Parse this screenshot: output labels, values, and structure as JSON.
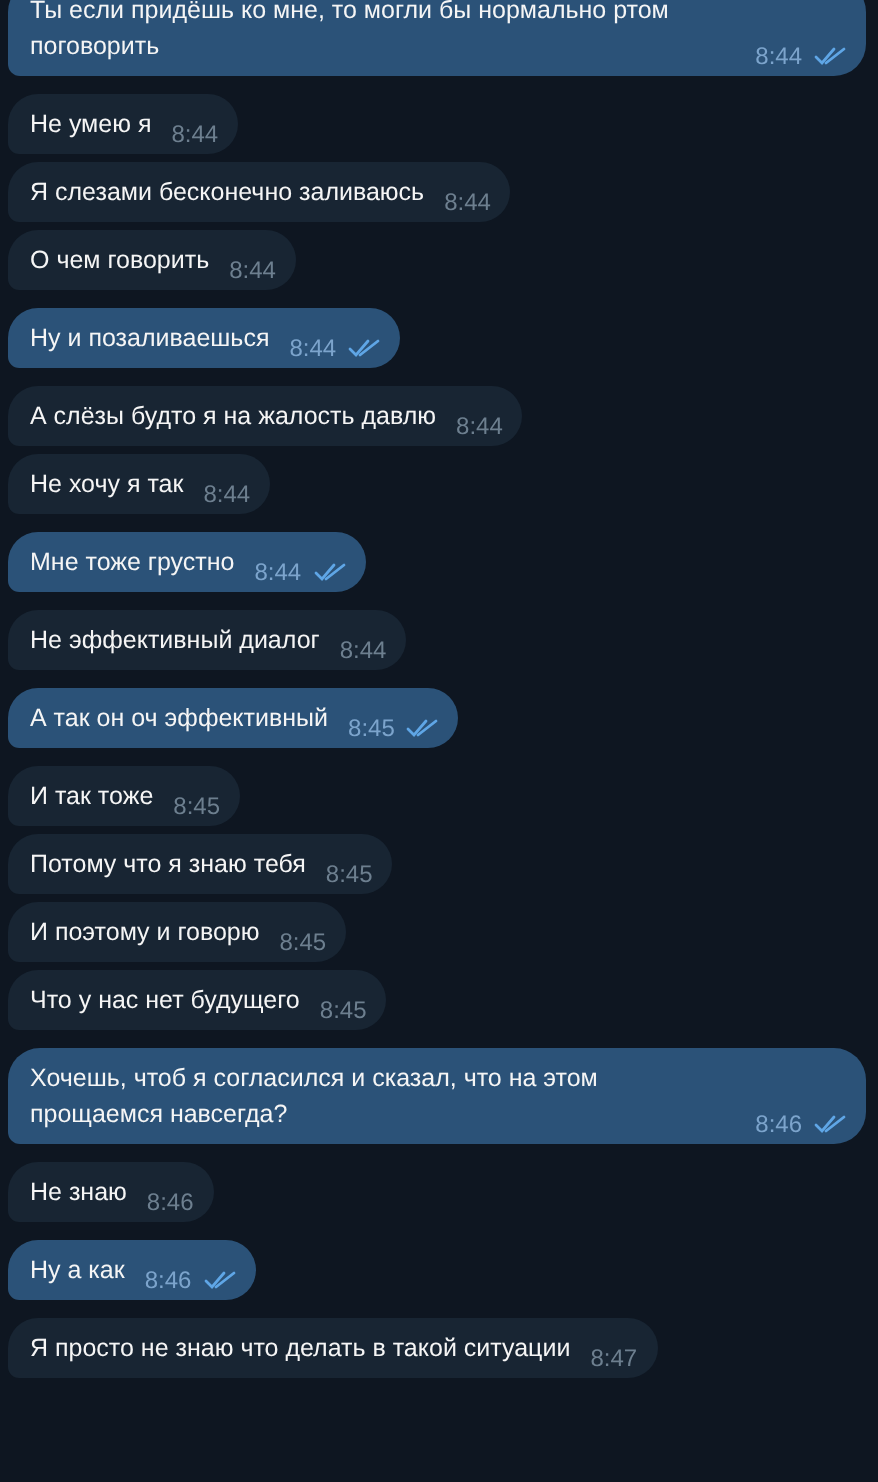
{
  "messages": [
    {
      "kind": "out",
      "text": "Ты если придёшь ко мне, то могли бы нормально ртом поговорить",
      "time": "8:44",
      "read": true
    },
    {
      "kind": "in",
      "text": "Не умею я",
      "time": "8:44"
    },
    {
      "kind": "in",
      "text": "Я слезами бесконечно заливаюсь",
      "time": "8:44"
    },
    {
      "kind": "in",
      "text": "О чем говорить",
      "time": "8:44"
    },
    {
      "kind": "out",
      "text": "Ну и позаливаешься",
      "time": "8:44",
      "read": true
    },
    {
      "kind": "in",
      "text": "А слёзы будто я на жалость давлю",
      "time": "8:44"
    },
    {
      "kind": "in",
      "text": "Не хочу я так",
      "time": "8:44"
    },
    {
      "kind": "out",
      "text": "Мне тоже грустно",
      "time": "8:44",
      "read": true
    },
    {
      "kind": "in",
      "text": "Не эффективный диалог",
      "time": "8:44"
    },
    {
      "kind": "out",
      "text": "А так он оч эффективный",
      "time": "8:45",
      "read": true
    },
    {
      "kind": "in",
      "text": "И так тоже",
      "time": "8:45"
    },
    {
      "kind": "in",
      "text": "Потому что я знаю тебя",
      "time": "8:45"
    },
    {
      "kind": "in",
      "text": "И поэтому и говорю",
      "time": "8:45"
    },
    {
      "kind": "in",
      "text": "Что у нас нет будущего",
      "time": "8:45"
    },
    {
      "kind": "out",
      "text": "Хочешь, чтоб я согласился и сказал, что на этом прощаемся навсегда?",
      "time": "8:46",
      "read": true
    },
    {
      "kind": "in",
      "text": "Не знаю",
      "time": "8:46"
    },
    {
      "kind": "out",
      "text": "Ну а как",
      "time": "8:46",
      "read": true
    },
    {
      "kind": "in",
      "text": "Я просто не знаю что делать в такой ситуации",
      "time": "8:47"
    }
  ]
}
